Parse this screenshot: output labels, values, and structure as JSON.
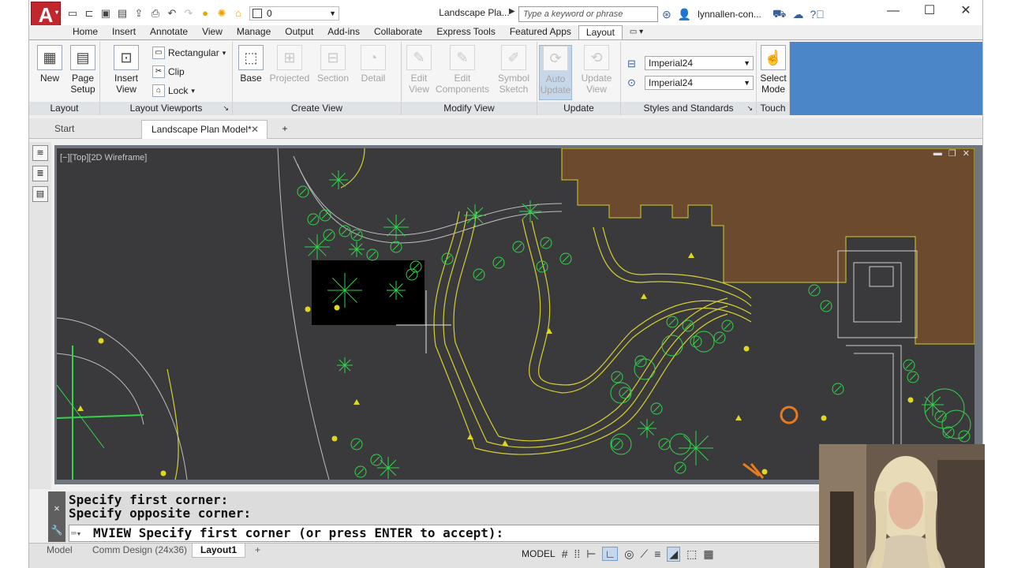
{
  "title_bar": {
    "app_logo": "A",
    "layer_value": "0",
    "doc_title": "Landscape Pla...",
    "search_placeholder": "Type a keyword or phrase",
    "user": "lynnallen-con...",
    "window_controls": [
      "minimize",
      "maximize",
      "close"
    ]
  },
  "ribbon_tabs": [
    "Home",
    "Insert",
    "Annotate",
    "View",
    "Manage",
    "Output",
    "Add-ins",
    "Collaborate",
    "Express Tools",
    "Featured Apps",
    "Layout"
  ],
  "ribbon_active_tab": "Layout",
  "ribbon": {
    "layout": {
      "title": "Layout",
      "new": "New",
      "page_setup_1": "Page",
      "page_setup_2": "Setup"
    },
    "layout_viewports": {
      "title": "Layout Viewports",
      "insert_view": "Insert View",
      "rectangular": "Rectangular",
      "clip": "Clip",
      "lock": "Lock"
    },
    "create_view": {
      "title": "Create View",
      "base": "Base",
      "projected": "Projected",
      "section": "Section",
      "detail": "Detail"
    },
    "modify_view": {
      "title": "Modify View",
      "edit_view_1": "Edit",
      "edit_view_2": "View",
      "edit_components_1": "Edit",
      "edit_components_2": "Components",
      "symbol_sketch_1": "Symbol",
      "symbol_sketch_2": "Sketch"
    },
    "update": {
      "title": "Update",
      "auto_update_1": "Auto",
      "auto_update_2": "Update",
      "update_view_1": "Update",
      "update_view_2": "View"
    },
    "styles": {
      "title": "Styles and Standards",
      "style_1": "Imperial24",
      "style_2": "Imperial24"
    },
    "touch": {
      "title": "Touch",
      "select_mode_1": "Select",
      "select_mode_2": "Mode"
    }
  },
  "file_tabs": {
    "start": "Start",
    "active": "Landscape Plan Model*"
  },
  "viewport": {
    "label": "[−][Top][2D Wireframe]"
  },
  "command_line": {
    "history_1": "Specify first corner:",
    "history_2": "Specify opposite corner:",
    "current": "MVIEW Specify first corner (or press ENTER to accept):"
  },
  "layout_tabs": [
    "Model",
    "Comm Design (24x36)",
    "Layout1"
  ],
  "layout_active": "Layout1",
  "status": {
    "mode": "MODEL"
  },
  "colors": {
    "canvas_bg": "#3a3a3d",
    "building_fill": "#6b4a2e",
    "plant_green": "#33d44a",
    "contour_yellow": "#d6cf2f",
    "accent_red": "#c1272d"
  }
}
